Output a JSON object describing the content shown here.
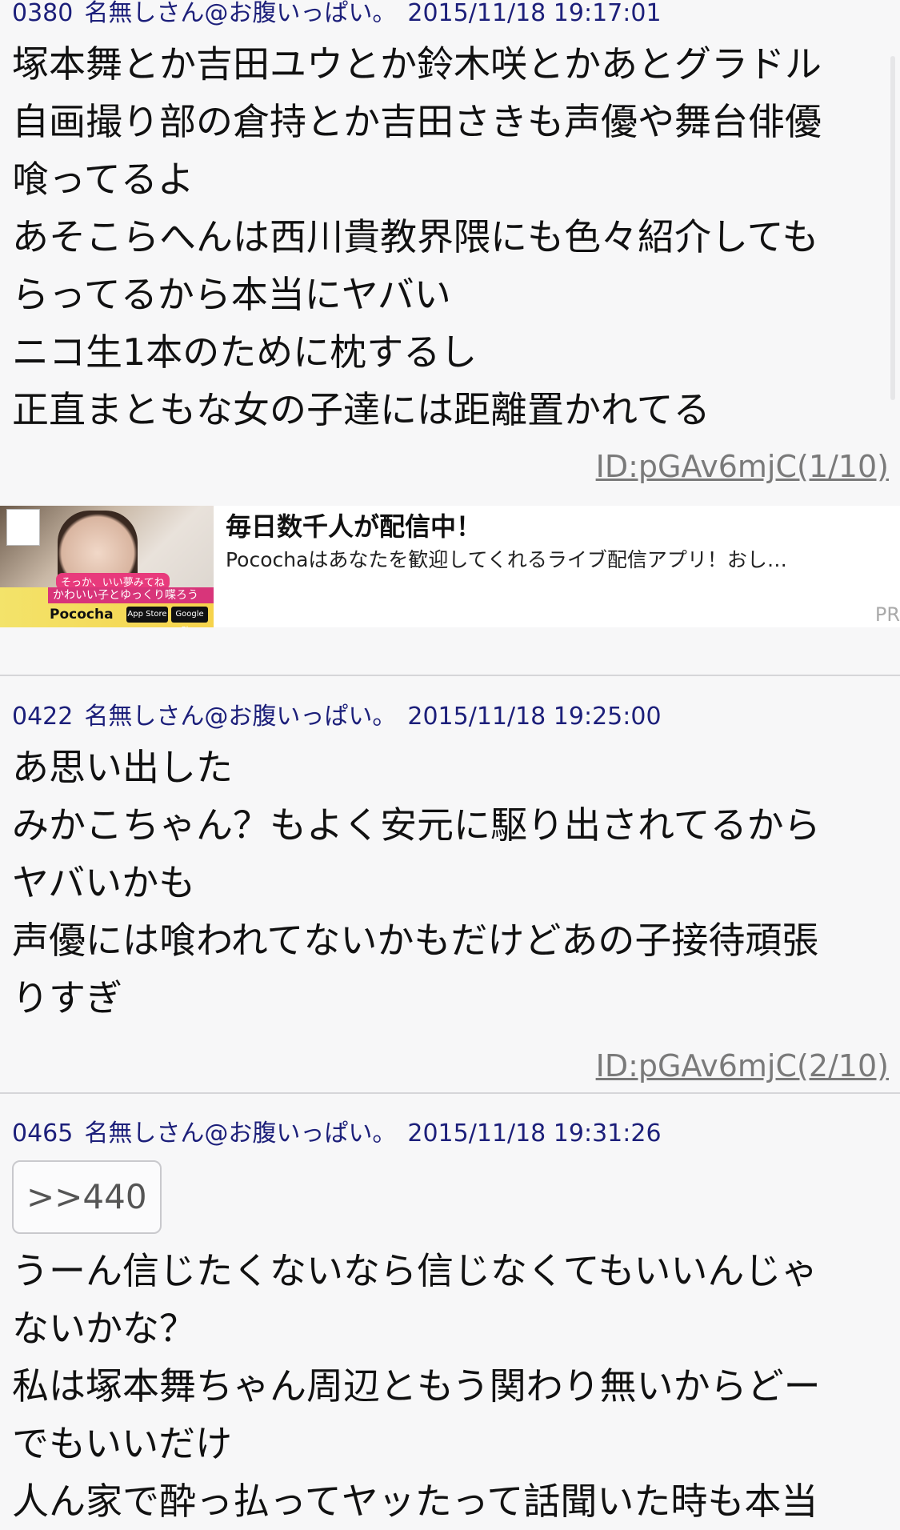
{
  "posts": [
    {
      "number": "0380",
      "name": "名無しさん@お腹いっぱい。",
      "datetime": "2015/11/18 19:17:01",
      "lines": [
        "塚本舞とか吉田ユウとか鈴木咲とかあとグラドル",
        "自画撮り部の倉持とか吉田さきも声優や舞台俳優",
        "喰ってるよ",
        "あそこらへんは西川貴教界隈にも色々紹介しても",
        "らってるから本当にヤバい",
        "ニコ生1本のために枕するし",
        "正直まともな女の子達には距離置かれてる"
      ],
      "id": "ID:pGAv6mjC(1/10)"
    },
    {
      "number": "0422",
      "name": "名無しさん@お腹いっぱい。",
      "datetime": "2015/11/18 19:25:00",
      "lines": [
        "あ思い出した",
        "みかこちゃん？もよく安元に駆り出されてるから",
        "ヤバいかも",
        "声優には喰われてないかもだけどあの子接待頑張",
        "りすぎ"
      ],
      "id": "ID:pGAv6mjC(2/10)"
    },
    {
      "number": "0465",
      "name": "名無しさん@お腹いっぱい。",
      "datetime": "2015/11/18 19:31:26",
      "anchor": ">>440",
      "lines": [
        "うーん信じたくないなら信じなくてもいいんじゃ",
        "ないかな？",
        "私は塚本舞ちゃん周辺ともう関わり無いからどー",
        "でもいいだけ",
        "人ん家で酔っ払ってヤッたって話聞いた時も本当"
      ]
    }
  ],
  "ad": {
    "title": "毎日数千人が配信中！",
    "description": "Pocochaはあなたを歓迎してくれるライブ配信アプリ！おし…",
    "pr": "PR",
    "thumb_tag": "そっか、いい夢みてね",
    "thumb_banner": "かわいい子とゆっくり喋ろう",
    "thumb_logo": "Pococha",
    "thumb_store1": "App Store",
    "thumb_store2": "Google Play"
  }
}
